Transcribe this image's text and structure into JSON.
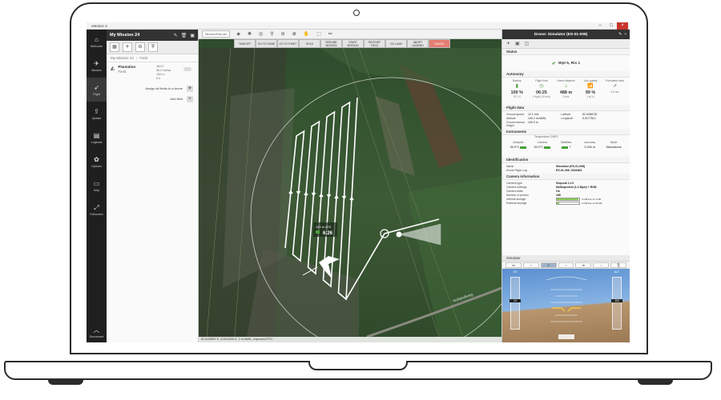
{
  "window": {
    "title": "eMotion 3"
  },
  "nav": {
    "items": [
      {
        "icon": "home-icon",
        "label": "Welcome"
      },
      {
        "icon": "mission-icon",
        "label": "Mission"
      },
      {
        "icon": "flight-icon",
        "label": "Flight"
      },
      {
        "icon": "update-icon",
        "label": "Update"
      },
      {
        "icon": "logbook-icon",
        "label": "Logbook"
      },
      {
        "icon": "gear-icon",
        "label": "Options"
      },
      {
        "icon": "help-icon",
        "label": "Help"
      },
      {
        "icon": "fullscreen-icon",
        "label": "Fullscreen"
      }
    ],
    "disconnect": "Disconnect"
  },
  "mission": {
    "name": "My Mission 24",
    "breadcrumb_root": "My Mission 24",
    "breadcrumb_child": "Field",
    "field": {
      "name": "Plantation",
      "type": "Field",
      "stats": [
        "18:01",
        "36.0 ha/ha",
        "100 m",
        "0.0"
      ]
    },
    "assign_all_label": "Assign all fields to a drone",
    "add_field_label": "Add field"
  },
  "map": {
    "basemap": "MissionPlanner",
    "commands": [
      "TAKEOFF",
      "GO TO HOME",
      "GO TO START",
      "HOLD",
      "RESUME MISSION",
      "START MISSION",
      "RESTART FIELD",
      "GO LAND",
      "ABORT LANDING",
      "CANCEL"
    ],
    "drone_label": "120 m AT0",
    "drone_time": "6:26",
    "road_label": "Hollandweg",
    "status_text": "52.0226597 E, 5.0013494 E, 2 m AMSL, Improved RTH"
  },
  "drone_panel": {
    "title": "Drone: Simulator (ES-01-008)",
    "status_section": "Status",
    "status_value": "Wpt 5, Ris 1",
    "autonomy_section": "Autonomy",
    "autonomy": [
      {
        "label": "Battery",
        "value": "100 %",
        "sub": "10.1 V"
      },
      {
        "label": "Flight time",
        "value": "06:25",
        "sub": "1 flight (10 min)"
      },
      {
        "label": "Home distance",
        "value": "488 m",
        "sub": "9 m/s"
      },
      {
        "label": "Link quality",
        "value": "99 %",
        "sub": "1 at 10"
      },
      {
        "label": "Estimated wind",
        "value": "",
        "sub": "6.9 m/s"
      }
    ],
    "flight_section": "Flight data",
    "flight": [
      [
        "Ground speed",
        "12.1 m/s",
        "Latitude",
        "52.0286732"
      ],
      [
        "Altitude",
        "100.2 m AMSL",
        "Longitude",
        "5.0177812"
      ],
      [
        "Ground sensor height",
        "100.3 m",
        "",
        ""
      ]
    ],
    "instruments_section": "Instruments",
    "instruments": [
      {
        "label": "Autopilot",
        "value": "35.0°C"
      },
      {
        "label": "Camera",
        "value": "35.0°C"
      },
      {
        "label": "Satellites",
        "value": "7"
      },
      {
        "label": "Accuracy",
        "value": "3.000 m"
      },
      {
        "label": "Mode",
        "value": "Standalone"
      }
    ],
    "instruments_header": "Temperature   GNSS",
    "identification_section": "Identification",
    "identification": [
      [
        "Name",
        "Simulator (ES-01-008)"
      ],
      [
        "Drone Flight Log",
        "ES-01-008_0016363"
      ]
    ],
    "camera_section": "Camera information",
    "camera": [
      [
        "Camera type",
        "Sequoia 1.2.0"
      ],
      [
        "Camera settings",
        "Multispectral (1.2 Mpix) + RGB"
      ],
      [
        "Camera state",
        "Ok"
      ],
      [
        "Number of photos",
        "168"
      ]
    ],
    "storage": [
      {
        "label": "Internal storage",
        "text": "4 GB free of 4 GB",
        "fraction": 0.95
      },
      {
        "label": "External storage",
        "text": "4 GB free of 32 GB",
        "fraction": 0.12
      }
    ]
  },
  "simulator": {
    "title": "Simulator",
    "controls": [
      "≪",
      "<",
      "II",
      ">",
      "≫",
      "♪",
      "⎘"
    ],
    "speed_label": "GS",
    "speed_value": "12",
    "alt_label": "ALT",
    "alt_value": "100"
  },
  "colors": {
    "accent": "#4aa03a",
    "danger": "#e57d73",
    "nav_bg": "#1f1f1f",
    "flight_path": "#ffffff"
  }
}
